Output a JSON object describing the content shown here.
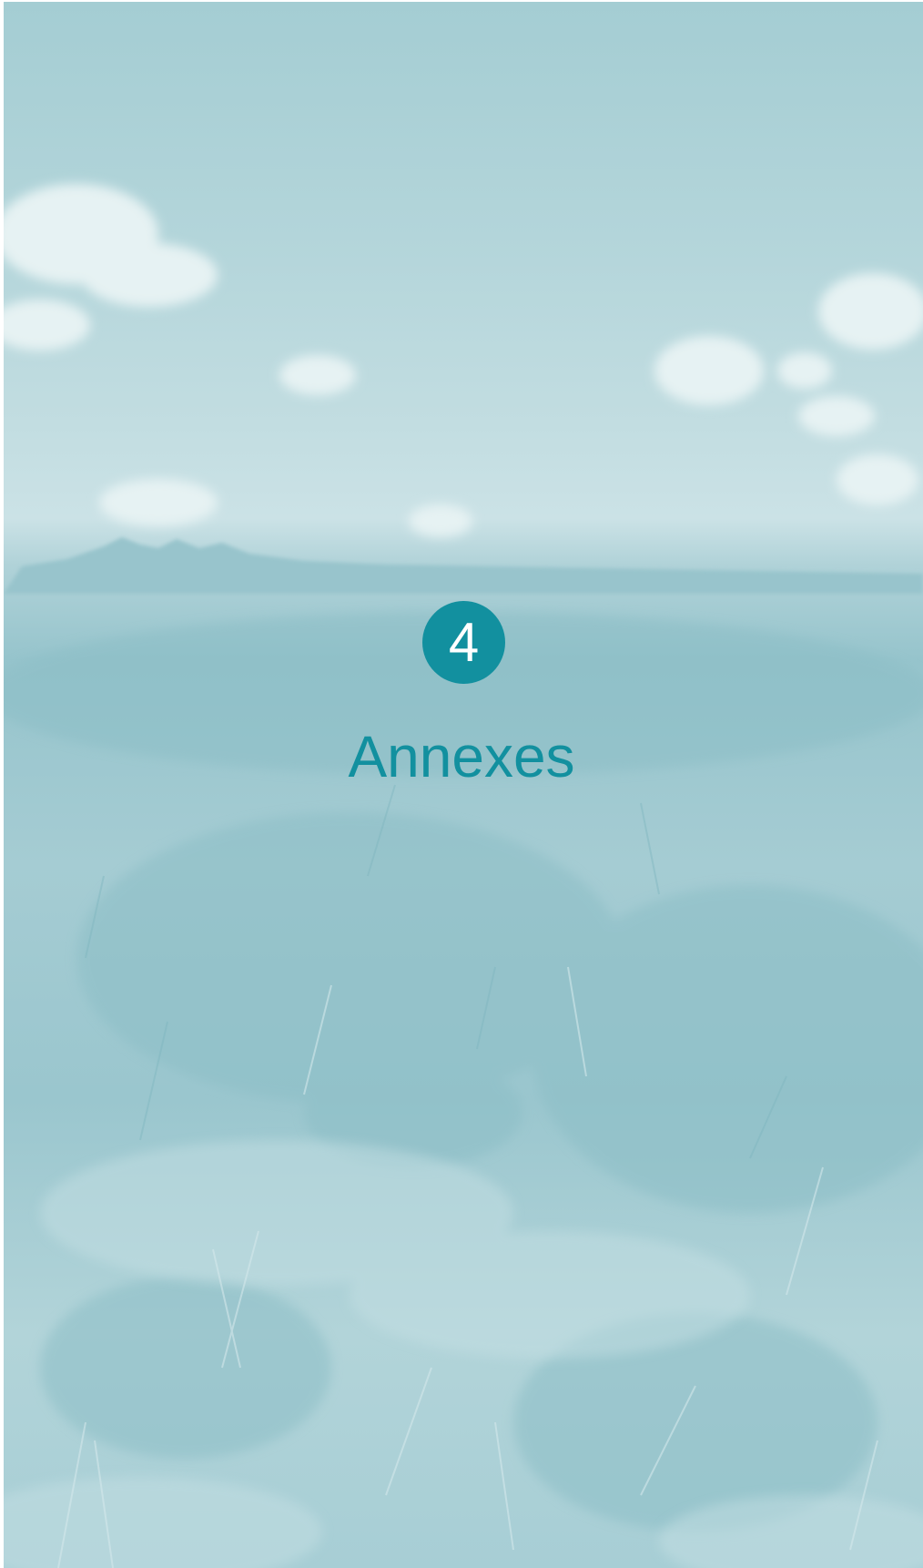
{
  "chapter": {
    "number": "4",
    "title": "Annexes"
  },
  "background": {
    "subject": "grassland-landscape-photo",
    "tint": "#a4cdd3"
  },
  "colors": {
    "accent": "#12909f",
    "badge_text": "#ffffff"
  }
}
